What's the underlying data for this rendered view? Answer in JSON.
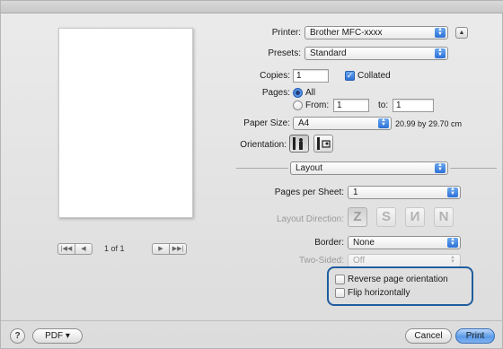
{
  "printer": {
    "label": "Printer:",
    "value": "Brother MFC-xxxx"
  },
  "presets": {
    "label": "Presets:",
    "value": "Standard"
  },
  "copies": {
    "label": "Copies:",
    "value": "1",
    "collated_label": "Collated",
    "collated_checked": true
  },
  "pages": {
    "label": "Pages:",
    "all_label": "All",
    "from_label": "From:",
    "from_value": "1",
    "to_label": "to:",
    "to_value": "1",
    "selected": "All"
  },
  "paper_size": {
    "label": "Paper Size:",
    "value": "A4",
    "dimensions": "20.99 by 29.70 cm"
  },
  "orientation": {
    "label": "Orientation:",
    "selected": "portrait"
  },
  "section": {
    "value": "Layout"
  },
  "layout": {
    "pages_per_sheet_label": "Pages per Sheet:",
    "pages_per_sheet_value": "1",
    "layout_direction_label": "Layout Direction:",
    "directions": [
      "Z",
      "S",
      "И",
      "N"
    ],
    "border_label": "Border:",
    "border_value": "None",
    "two_sided_label": "Two-Sided:",
    "two_sided_value": "Off",
    "reverse_label": "Reverse page orientation",
    "flip_label": "Flip horizontally"
  },
  "preview": {
    "page_count": "1 of 1"
  },
  "footer": {
    "help": "?",
    "pdf_label": "PDF ▾",
    "cancel_label": "Cancel",
    "print_label": "Print"
  },
  "colors": {
    "accent": "#2c70d6",
    "highlight": "#1f5d9e",
    "window_bg": "#e3e3e3"
  }
}
